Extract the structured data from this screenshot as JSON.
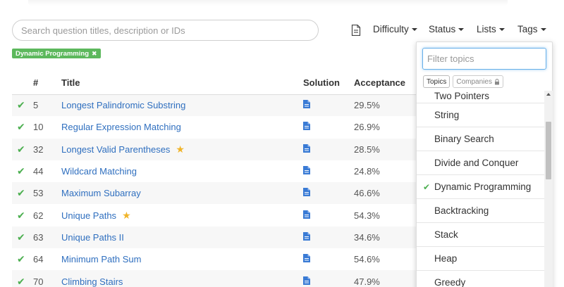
{
  "search": {
    "placeholder": "Search question titles, description or IDs"
  },
  "toolbar": {
    "difficulty": "Difficulty",
    "status": "Status",
    "lists": "Lists",
    "tags": "Tags"
  },
  "active_filter": {
    "label": "Dynamic Programming",
    "remove": "✖"
  },
  "table": {
    "headers": {
      "num": "#",
      "title": "Title",
      "solution": "Solution",
      "acceptance": "Acceptance"
    },
    "rows": [
      {
        "num": "5",
        "title": "Longest Palindromic Substring",
        "acceptance": "29.5%",
        "starred": false
      },
      {
        "num": "10",
        "title": "Regular Expression Matching",
        "acceptance": "26.9%",
        "starred": false
      },
      {
        "num": "32",
        "title": "Longest Valid Parentheses",
        "acceptance": "28.5%",
        "starred": true
      },
      {
        "num": "44",
        "title": "Wildcard Matching",
        "acceptance": "24.8%",
        "starred": false
      },
      {
        "num": "53",
        "title": "Maximum Subarray",
        "acceptance": "46.6%",
        "starred": false
      },
      {
        "num": "62",
        "title": "Unique Paths",
        "acceptance": "54.3%",
        "starred": true
      },
      {
        "num": "63",
        "title": "Unique Paths II",
        "acceptance": "34.6%",
        "starred": false
      },
      {
        "num": "64",
        "title": "Minimum Path Sum",
        "acceptance": "54.6%",
        "starred": false
      },
      {
        "num": "70",
        "title": "Climbing Stairs",
        "acceptance": "47.9%",
        "starred": false
      }
    ]
  },
  "tags_dropdown": {
    "filter_placeholder": "Filter topics",
    "tabs": {
      "topics": "Topics",
      "companies": "Companies"
    },
    "topics": [
      {
        "label": "Two Pointers",
        "selected": false
      },
      {
        "label": "String",
        "selected": false
      },
      {
        "label": "Binary Search",
        "selected": false
      },
      {
        "label": "Divide and Conquer",
        "selected": false
      },
      {
        "label": "Dynamic Programming",
        "selected": true
      },
      {
        "label": "Backtracking",
        "selected": false
      },
      {
        "label": "Stack",
        "selected": false
      },
      {
        "label": "Heap",
        "selected": false
      },
      {
        "label": "Greedy",
        "selected": false
      }
    ]
  },
  "colors": {
    "accent_green": "#5cb85c",
    "link_blue": "#2f6fbf",
    "star": "#f0b429"
  }
}
